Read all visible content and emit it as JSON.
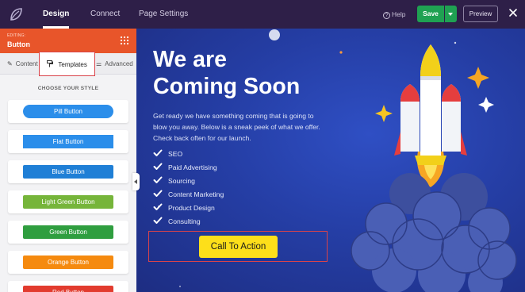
{
  "topbar": {
    "tabs": [
      "Design",
      "Connect",
      "Page Settings"
    ],
    "help_label": "Help",
    "save_label": "Save",
    "preview_label": "Preview"
  },
  "panel": {
    "editing_label": "EDITING:",
    "editing_title": "Button",
    "tabs": [
      "Content",
      "Templates",
      "Advanced"
    ],
    "choose_label": "CHOOSE YOUR STYLE",
    "templates": [
      {
        "label": "Pill Button",
        "color": "#2b8eea",
        "style": "pill"
      },
      {
        "label": "Flat Button",
        "color": "#2b8eea",
        "style": "flat"
      },
      {
        "label": "Blue Button",
        "color": "#1f7fd6",
        "style": "rounded"
      },
      {
        "label": "Light Green Button",
        "color": "#76b53a",
        "style": "rounded"
      },
      {
        "label": "Green Button",
        "color": "#2f9e3f",
        "style": "rounded"
      },
      {
        "label": "Orange Button",
        "color": "#f58a0f",
        "style": "rounded"
      },
      {
        "label": "Red Button",
        "color": "#e23b2e",
        "style": "rounded"
      }
    ]
  },
  "canvas": {
    "headline_line1": "We are",
    "headline_line2": "Coming Soon",
    "subtext": "Get ready we have something coming that is going to blow you away. Below is a sneak peek of what we offer. Check back often for our launch.",
    "list": [
      "SEO",
      "Paid Advertising",
      "Sourcing",
      "Content Marketing",
      "Product Design",
      "Consulting"
    ],
    "cta_label": "Call To Action"
  },
  "colors": {
    "topbar_bg": "#2e1f48",
    "accent_orange": "#e8552a",
    "save_green": "#1fa152",
    "cta_yellow": "#fddf1a",
    "canvas_blue": "#253ea5",
    "highlight_red": "#d9434a"
  },
  "icons": {
    "logo": "seedprod-leaf-icon",
    "help": "question-circle-icon",
    "close": "close-icon",
    "grid": "grid-dots-icon",
    "content_tab": "pencil-icon",
    "templates_tab": "paint-roller-icon",
    "advanced_tab": "sliders-icon",
    "check": "check-icon",
    "illustration": "rocket-illustration"
  }
}
